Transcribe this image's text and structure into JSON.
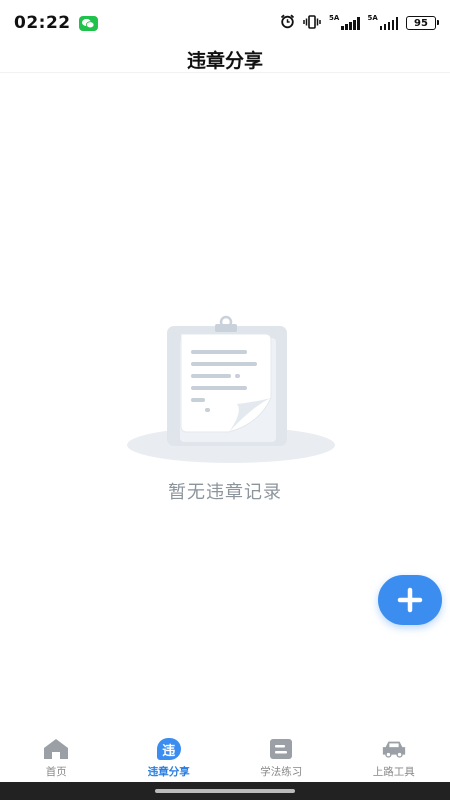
{
  "status_bar": {
    "time": "02:22",
    "signal_1_label": "5A",
    "signal_2_label": "5A",
    "battery": "95"
  },
  "header": {
    "title": "违章分享"
  },
  "empty_state": {
    "message": "暂无违章记录"
  },
  "fab": {
    "icon": "plus-icon"
  },
  "tabs": [
    {
      "label": "首页",
      "icon": "home-icon"
    },
    {
      "label": "违章分享",
      "icon": "violation-share-icon",
      "badge": "违",
      "active": true
    },
    {
      "label": "学法练习",
      "icon": "study-icon"
    },
    {
      "label": "上路工具",
      "icon": "car-icon"
    }
  ],
  "colors": {
    "accent": "#3b8df0",
    "active_tab_text": "#2a7de1",
    "inactive_tab": "#888888",
    "empty_text": "#8c949c"
  }
}
